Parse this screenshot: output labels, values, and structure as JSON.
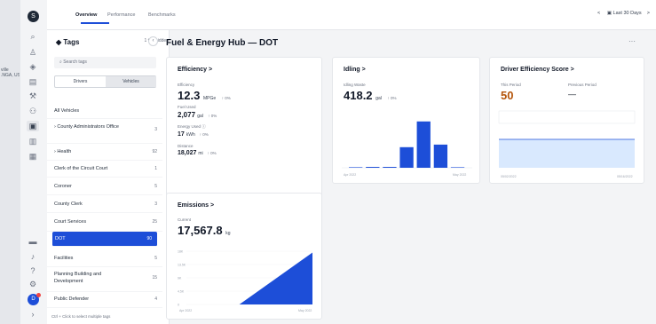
{
  "background": {
    "map_label": "ville\n.NGA, US"
  },
  "nav": {
    "logo_glyph": "S",
    "avatar_glyph": "D",
    "icons": [
      "search-icon",
      "users-icon",
      "shield-icon",
      "route-icon",
      "wrench-icon",
      "people-icon",
      "fuel-icon",
      "document-icon",
      "reports-icon",
      "chat-icon",
      "bell-icon",
      "help-icon",
      "gear-icon"
    ]
  },
  "topbar": {
    "tabs": [
      "Overview",
      "Performance",
      "Benchmarks"
    ],
    "date_range": "Last 30 Days",
    "prev_arrow": "<",
    "next_arrow": ">",
    "calendar_glyph": "▣"
  },
  "tags": {
    "title": "Tags",
    "hidden_count": "1 tag hidden",
    "search_placeholder": "Search tags",
    "toggle": [
      "Drivers",
      "Vehicles"
    ],
    "rows": [
      {
        "name": "All Vehicles",
        "count": ""
      },
      {
        "name": "› County Administrators Office",
        "count": "3"
      },
      {
        "name": "› Health",
        "count": "92"
      },
      {
        "name": "Clerk of the Circuit Court",
        "count": "1"
      },
      {
        "name": "Coroner",
        "count": "5"
      },
      {
        "name": "County Clerk",
        "count": "3"
      },
      {
        "name": "Court Services",
        "count": "25"
      },
      {
        "name": "DOT",
        "count": "90"
      },
      {
        "name": "Facilities",
        "count": "5"
      },
      {
        "name": "Planning Building and Development",
        "count": "15"
      },
      {
        "name": "Public Defender",
        "count": "4"
      }
    ],
    "footer": "Ctrl + Click to select multiple tags"
  },
  "main": {
    "title": "Fuel & Energy Hub — DOT",
    "more": "···"
  },
  "efficiency": {
    "title": "Efficiency >",
    "metrics": [
      {
        "label": "Efficiency",
        "value": "12.3",
        "unit": "MPGe",
        "delta": "↑ 0%"
      },
      {
        "label": "Fuel Used",
        "value": "2,077",
        "unit": "gal",
        "delta": "↑ 0%"
      },
      {
        "label": "Energy Used",
        "value": "17",
        "unit": "kWh",
        "delta": "↑ 0%"
      },
      {
        "label": "Distance",
        "value": "18,027",
        "unit": "mi",
        "delta": "↑ 0%"
      }
    ]
  },
  "idling": {
    "title": "Idling >",
    "label": "Idling Waste",
    "value": "418.2",
    "unit": "gal",
    "delta": "↑ 0%",
    "x_start": "Apr 2022",
    "x_end": "May 2022"
  },
  "driver_score": {
    "title": "Driver Efficiency Score >",
    "this_label": "This Period",
    "this_value": "50",
    "prev_label": "Previous Period",
    "prev_value": "—",
    "x_start": "05/02/2022",
    "x_end": "05/16/2022"
  },
  "emissions": {
    "title": "Emissions >",
    "label": "Current",
    "value": "17,567.8",
    "unit": "kg",
    "x_start": "Apr 2022",
    "x_end": "May 2022"
  },
  "chart_data": [
    {
      "type": "bar",
      "title": "Idling >",
      "categories": [
        "1",
        "2",
        "3",
        "4",
        "5",
        "6",
        "7"
      ],
      "values": [
        0,
        1,
        1,
        24,
        54,
        27,
        0
      ],
      "ylim": [
        0,
        60
      ]
    },
    {
      "type": "area",
      "title": "Driver Efficiency Score >",
      "x": [
        "05/02/2022",
        "05/16/2022"
      ],
      "values": [
        50,
        50
      ],
      "ylim": [
        0,
        100
      ]
    },
    {
      "type": "area",
      "title": "Emissions >",
      "y_ticks": [
        "0",
        "4.5K",
        "9K",
        "13.5K",
        "18K"
      ],
      "x": [
        0,
        0.42,
        1
      ],
      "values": [
        0,
        0,
        17567.8
      ],
      "ylim": [
        0,
        18000
      ]
    }
  ],
  "colors": {
    "accent": "#1d4ed8",
    "score": "#b45309",
    "score_fill": "#bfdbfe"
  }
}
